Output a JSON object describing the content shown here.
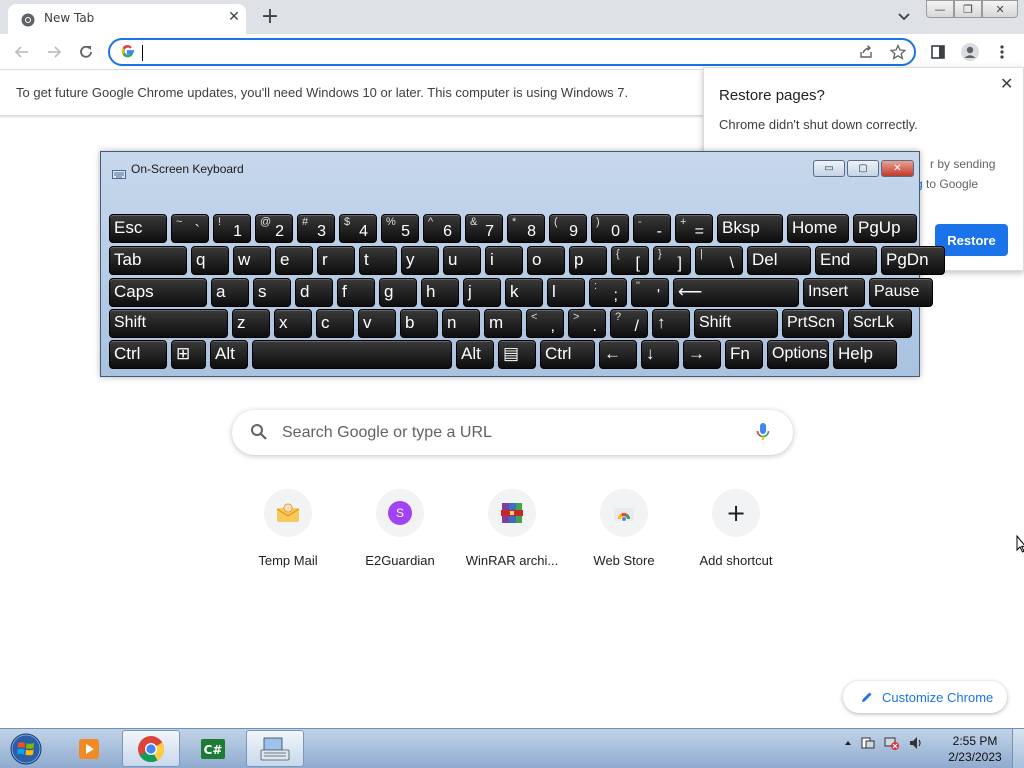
{
  "browser": {
    "tab_title": "New Tab",
    "tab_close": "✕",
    "new_tab": "+",
    "omnibox_value": "",
    "window_controls": [
      "—",
      "❐",
      "✕"
    ]
  },
  "infobar": {
    "text": "To get future Google Chrome updates, you'll need Windows 10 or later. This computer is using Windows 7."
  },
  "restore_popup": {
    "title": "Restore pages?",
    "message": "Chrome didn't shut down correctly.",
    "partial_line1": "r by sending",
    "partial_link": "g",
    "partial_line2": " to Google",
    "button": "Restore",
    "close": "✕"
  },
  "osk": {
    "title": "On-Screen Keyboard",
    "buttons": [
      "▭",
      "▢",
      "✕"
    ],
    "keys": [
      {
        "label": "Esc"
      },
      {
        "shift": "~",
        "main": "`"
      },
      {
        "shift": "!",
        "main": "1"
      },
      {
        "shift": "@",
        "main": "2"
      },
      {
        "shift": "#",
        "main": "3"
      },
      {
        "shift": "$",
        "main": "4"
      },
      {
        "shift": "%",
        "main": "5"
      },
      {
        "shift": "^",
        "main": "6"
      },
      {
        "shift": "&",
        "main": "7"
      },
      {
        "shift": "*",
        "main": "8"
      },
      {
        "shift": "(",
        "main": "9"
      },
      {
        "shift": ")",
        "main": "0"
      },
      {
        "shift": "-",
        "main": "-"
      },
      {
        "shift": "+",
        "main": "="
      },
      {
        "label": "Bksp"
      },
      {
        "label": "Home"
      },
      {
        "label": "PgUp"
      },
      {
        "label": "Tab"
      },
      {
        "label": "q"
      },
      {
        "label": "w"
      },
      {
        "label": "e"
      },
      {
        "label": "r"
      },
      {
        "label": "t"
      },
      {
        "label": "y"
      },
      {
        "label": "u"
      },
      {
        "label": "i"
      },
      {
        "label": "o"
      },
      {
        "label": "p"
      },
      {
        "shift": "{",
        "main": "["
      },
      {
        "shift": "}",
        "main": "]"
      },
      {
        "shift": "|",
        "main": "\\"
      },
      {
        "label": "Del"
      },
      {
        "label": "End"
      },
      {
        "label": "PgDn"
      },
      {
        "label": "Caps"
      },
      {
        "label": "a"
      },
      {
        "label": "s"
      },
      {
        "label": "d"
      },
      {
        "label": "f"
      },
      {
        "label": "g"
      },
      {
        "label": "h"
      },
      {
        "label": "j"
      },
      {
        "label": "k"
      },
      {
        "label": "l"
      },
      {
        "shift": ":",
        "main": ";"
      },
      {
        "shift": "\"",
        "main": "'"
      },
      {
        "label": "⟵"
      },
      {
        "label": "Insert"
      },
      {
        "label": "Pause"
      },
      {
        "label": "Shift"
      },
      {
        "label": "z"
      },
      {
        "label": "x"
      },
      {
        "label": "c"
      },
      {
        "label": "v"
      },
      {
        "label": "b"
      },
      {
        "label": "n"
      },
      {
        "label": "m"
      },
      {
        "shift": "<",
        "main": ","
      },
      {
        "shift": ">",
        "main": "."
      },
      {
        "shift": "?",
        "main": "/"
      },
      {
        "label": "↑"
      },
      {
        "label": "Shift"
      },
      {
        "label": "PrtScn"
      },
      {
        "label": "ScrLk"
      },
      {
        "label": "Ctrl"
      },
      {
        "label": "⊞"
      },
      {
        "label": "Alt"
      },
      {
        "label": ""
      },
      {
        "label": "Alt"
      },
      {
        "label": "▤"
      },
      {
        "label": "Ctrl"
      },
      {
        "label": "←"
      },
      {
        "label": "↓"
      },
      {
        "label": "→"
      },
      {
        "label": "Fn"
      },
      {
        "label": "Options"
      },
      {
        "label": "Help"
      }
    ]
  },
  "search": {
    "placeholder": "Search Google or type a URL"
  },
  "shortcuts": [
    {
      "label": "Temp Mail",
      "icon": "email-icon"
    },
    {
      "label": "E2Guardian",
      "icon": "letter-s-icon",
      "letter": "S"
    },
    {
      "label": "WinRAR archi...",
      "icon": "winrar-icon"
    },
    {
      "label": "Web Store",
      "icon": "chrome-web-store-icon"
    },
    {
      "label": "Add shortcut",
      "icon": "plus-icon",
      "glyph": "+"
    }
  ],
  "customize": {
    "label": "Customize Chrome"
  },
  "taskbar": {
    "time": "2:55 PM",
    "date": "2/23/2023"
  },
  "colors": {
    "accent": "#1a73e8",
    "taskbar": "#a9c2e0",
    "e2guardian": "#a142f4"
  }
}
